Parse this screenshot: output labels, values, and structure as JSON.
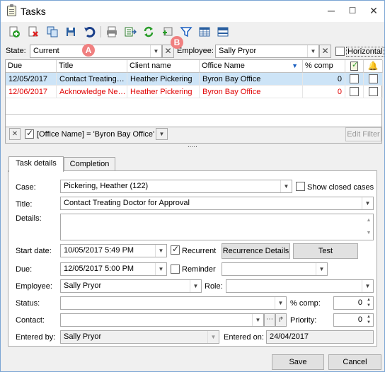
{
  "window": {
    "title": "Tasks",
    "minimize": "─",
    "maximize": "☐",
    "close": "✕"
  },
  "toolbar": {
    "icons": [
      "add-icon",
      "delete-icon",
      "copy-icon",
      "save-icon",
      "undo-icon",
      "print-icon",
      "export-icon",
      "refresh-icon",
      "filter-add-icon",
      "filter-icon",
      "grid-icon",
      "layout-icon"
    ]
  },
  "filters": {
    "state_label": "State:",
    "state_value": "Current",
    "employee_label": "Employee:",
    "employee_value": "Sally Pryor",
    "horizontal_label": "Horizontal",
    "badge_a": "A",
    "badge_b": "B"
  },
  "grid": {
    "columns": [
      "Due",
      "Title",
      "Client name",
      "Office Name",
      "% comp"
    ],
    "rows": [
      {
        "due": "12/05/2017",
        "title": "Contact Treating…",
        "client": "Heather Pickering",
        "office": "Byron Bay Office",
        "pct": "0",
        "selected": true,
        "overdue": false
      },
      {
        "due": "12/06/2017",
        "title": "Acknowledge Ne…",
        "client": "Heather Pickering",
        "office": "Byron Bay Office",
        "pct": "0",
        "selected": false,
        "overdue": true
      }
    ]
  },
  "filterbar": {
    "expression": "[Office Name] = 'Byron Bay Office'",
    "edit_filter": "Edit Filter",
    "splitter": "....."
  },
  "tabs": [
    "Task details",
    "Completion"
  ],
  "details": {
    "case_label": "Case:",
    "case_value": "Pickering, Heather (122)",
    "show_closed": "Show closed cases",
    "title_label": "Title:",
    "title_value": "Contact Treating Doctor for Approval",
    "details_label": "Details:",
    "start_label": "Start date:",
    "start_value": "10/05/2017 5:49 PM",
    "recurrent_label": "Recurrent",
    "recurrence_btn": "Recurrence Details",
    "test_btn": "Test",
    "due_label": "Due:",
    "due_value": "12/05/2017 5:00 PM",
    "reminder_label": "Reminder",
    "employee_label": "Employee:",
    "employee_value": "Sally Pryor",
    "role_label": "Role:",
    "status_label": "Status:",
    "pctcomp_label": "% comp:",
    "pctcomp_value": "0",
    "contact_label": "Contact:",
    "priority_label": "Priority:",
    "priority_value": "0",
    "entered_by_label": "Entered by:",
    "entered_by_value": "Sally Pryor",
    "entered_on_label": "Entered on:",
    "entered_on_value": "24/04/2017"
  },
  "buttons": {
    "save": "Save",
    "cancel": "Cancel"
  }
}
